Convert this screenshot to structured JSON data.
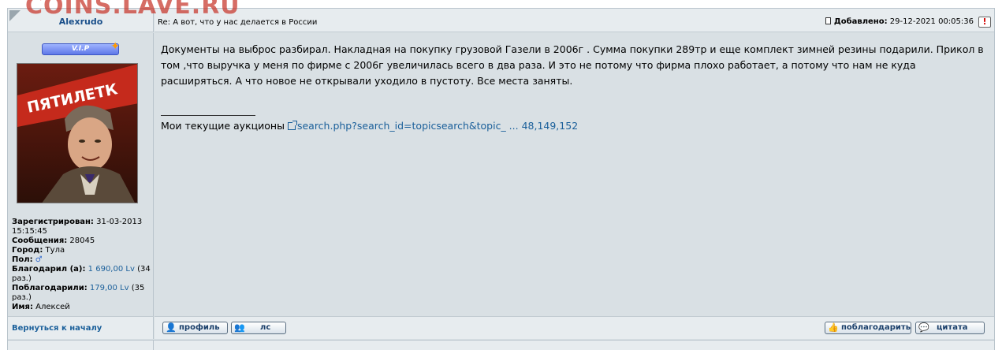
{
  "watermark": "COINS.LAVE.RU",
  "post": {
    "author": "Alexrudo",
    "subject": "Re: А вот, что у нас делается в России",
    "posted_label": "Добавлено:",
    "posted_value": "29-12-2021 00:05:36",
    "report_label": "!",
    "body": "Документы на выброс разбирал. Накладная на покупку грузовой Газели в 2006г . Сумма покупки 289тр и еще комплект зимней резины подарили. Прикол в том ,что выручка у меня по фирме с 2006г увеличилась всего в два раза. И это не потому что фирма плохо работает, а потому что нам не куда расширяться. А что новое не открывали уходило в пустоту. Все места заняты.",
    "signature_text": "Мои текущие аукционы",
    "signature_link": "search.php?search_id=topicsearch&topic_ ... 48,149,152"
  },
  "user": {
    "badge": "V.I.P",
    "avatar_caption": "ПЯТИЛЕТК",
    "registered_label": "Зарегистрирован:",
    "registered_value": "31-03-2013 15:15:45",
    "messages_label": "Сообщения:",
    "messages_value": "28045",
    "city_label": "Город:",
    "city_value": "Тула",
    "gender_label": "Пол:",
    "thanked_label": "Благодарил (а):",
    "thanked_value": "1 690,00 Lv",
    "thanked_count": "(34 раз.)",
    "was_thanked_label": "Поблагодарили:",
    "was_thanked_value": "179,00 Lv",
    "was_thanked_count": "(35 раз.)",
    "name_label": "Имя:",
    "name_value": "Алексей"
  },
  "footer": {
    "back_to_top": "Вернуться к началу",
    "profile": "профиль",
    "pm": "лс",
    "thank": "поблагодарить",
    "quote": "цитата"
  },
  "icons": {
    "gender": "male-icon",
    "report": "warning-icon",
    "badge_star": "star-icon"
  },
  "colors": {
    "link": "#1a5f9a",
    "author": "#1a4f8a",
    "panel": "#d9e0e4",
    "header": "#e7ecef",
    "watermark": "#c83c32"
  }
}
